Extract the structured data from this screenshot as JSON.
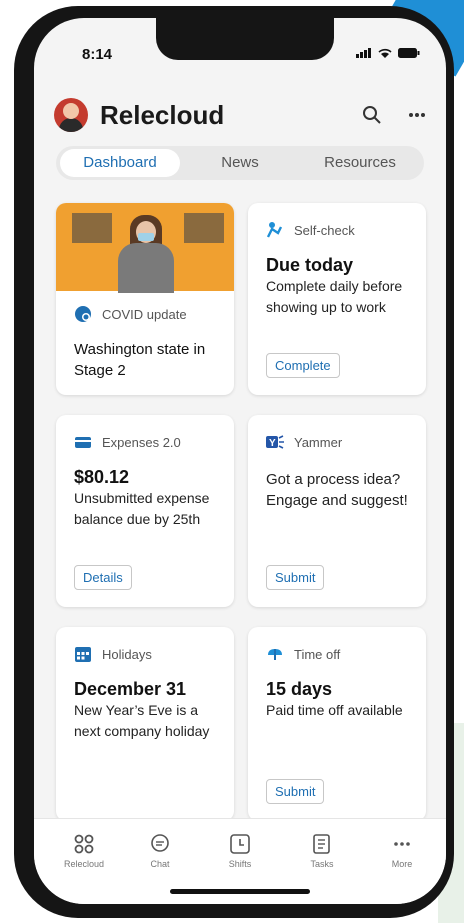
{
  "status": {
    "time": "8:14",
    "signal_icon": "signal-icon",
    "wifi_icon": "wifi-icon",
    "battery_icon": "battery-icon"
  },
  "header": {
    "title": "Relecloud",
    "search_icon": "search-icon",
    "more_icon": "more-icon"
  },
  "tabs": [
    {
      "label": "Dashboard",
      "active": true
    },
    {
      "label": "News"
    },
    {
      "label": "Resources"
    }
  ],
  "cards": {
    "covid": {
      "category": "COVID update",
      "text": "Washington state in Stage 2",
      "icon": "covid-icon"
    },
    "selfcheck": {
      "category": "Self-check",
      "title": "Due today",
      "text": "Complete daily before showing up to work",
      "button": "Complete",
      "icon": "selfcheck-icon"
    },
    "expenses": {
      "category": "Expenses 2.0",
      "title": "$80.12",
      "text": "Unsubmitted expense balance due by 25th",
      "button": "Details",
      "icon": "card-icon"
    },
    "yammer": {
      "category": "Yammer",
      "text": "Got a process idea? Engage and suggest!",
      "button": "Submit",
      "icon": "yammer-icon"
    },
    "holidays": {
      "category": "Holidays",
      "title": "December 31",
      "text": "New Year’s Eve is a next company holiday",
      "icon": "calendar-icon"
    },
    "timeoff": {
      "category": "Time off",
      "title": "15 days",
      "text": "Paid time off available",
      "button": "Submit",
      "icon": "timeoff-icon"
    }
  },
  "bottom_nav": [
    {
      "label": "Relecloud",
      "icon": "app-icon"
    },
    {
      "label": "Chat",
      "icon": "chat-icon"
    },
    {
      "label": "Shifts",
      "icon": "shifts-icon"
    },
    {
      "label": "Tasks",
      "icon": "tasks-icon"
    },
    {
      "label": "More",
      "icon": "more-icon"
    }
  ],
  "colors": {
    "accent": "#1f6fb2",
    "photo_bg": "#f0a030",
    "brand_blue": "#1f8fd6"
  }
}
